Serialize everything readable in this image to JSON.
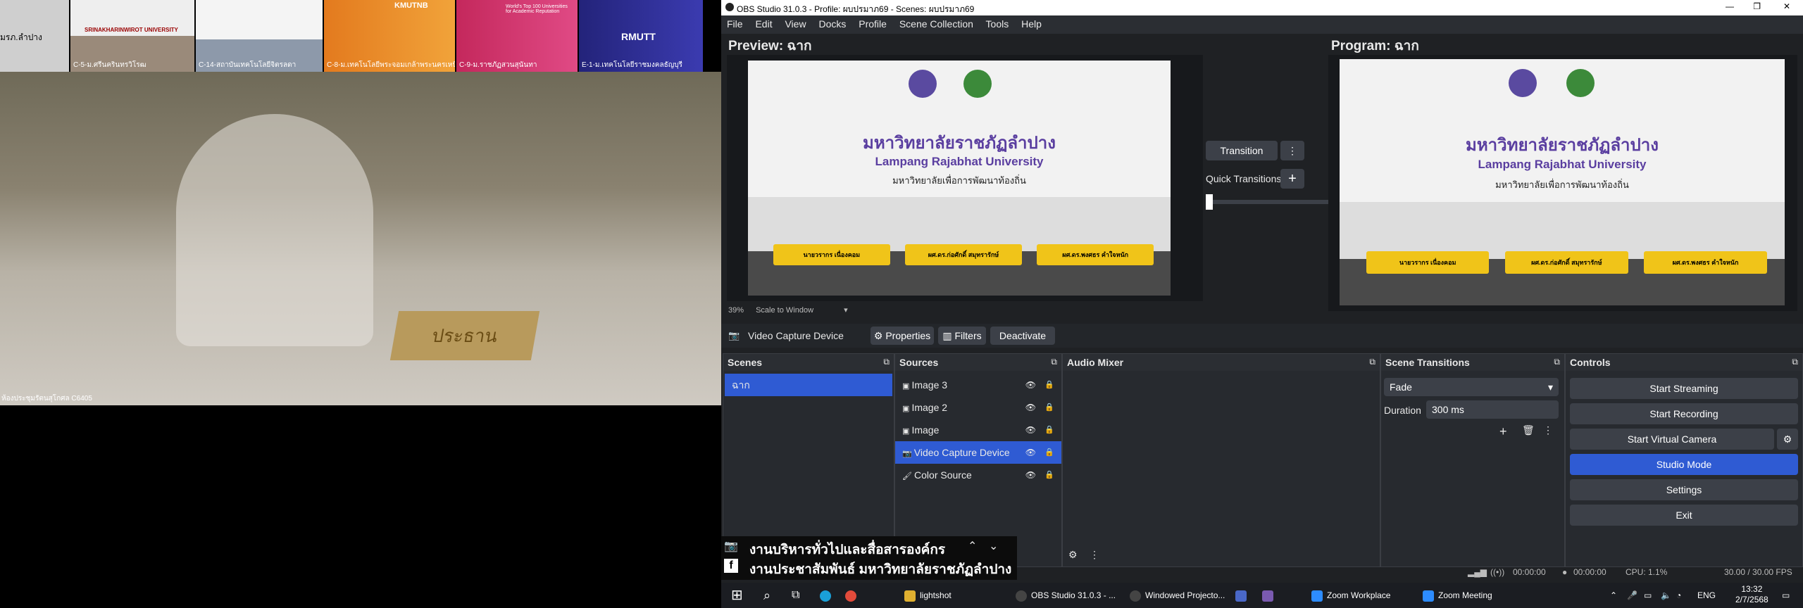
{
  "left": {
    "thumbs": [
      {
        "label": "มรภ.ลำปาง",
        "caption": ""
      },
      {
        "label": "SRINAKHARINWIROT UNIVERSITY",
        "caption": "C-5-ม.ศรีนครินทรวิโรฒ"
      },
      {
        "label": "",
        "caption": "C-14-สถาบันเทคโนโลยีจิตรลดา"
      },
      {
        "label": "KMUTNB",
        "caption": "C-8-ม.เทคโนโลยีพระจอมเกล้าพระนครเหนือ"
      },
      {
        "label": "World's Top 100 Universities for Academic Reputation",
        "caption": "C-9-ม.ราชภัฏสวนสุนันทา"
      },
      {
        "label": "RMUTT",
        "caption": "E-1-ม.เทคโนโลยีราชมงคลธัญบุรี"
      }
    ],
    "main_caption": "ห้องประชุมรัตนสุโกศล C6405",
    "sign": "ประธาน"
  },
  "overlay": {
    "line1": "งานบริหารทั่วไปและสื่อสารองค์กร",
    "line2": "งานประชาสัมพันธ์ มหาวิทยาลัยราชภัฏลำปาง"
  },
  "obs": {
    "title": "OBS Studio 31.0.3 - Profile: ผบปรมาภ69 - Scenes: ผบปรมาภ69",
    "menu": [
      "File",
      "Edit",
      "View",
      "Docks",
      "Profile",
      "Scene Collection",
      "Tools",
      "Help"
    ],
    "preview_label": "Preview: ฉาก",
    "program_label": "Program: ฉาก",
    "transition_button": "Transition",
    "quick_transitions": "Quick Transitions",
    "zoom": "39%",
    "scale": "Scale to Window",
    "screen": {
      "uni_th": "มหาวิทยาลัยราชภัฏลำปาง",
      "uni_en": "Lampang Rajabhat University",
      "motto": "มหาวิทยาลัยเพื่อการพัฒนาท้องถิ่น",
      "names": [
        "นายวรากร เนื่องคอม",
        "ผศ.ดร.ก่อศักดิ์ สมุทรารักษ์",
        "ผศ.ดร.พงศธร คำใจหนัก"
      ]
    },
    "source_toolbar": {
      "selected": "Video Capture Device",
      "properties": "Properties",
      "filters": "Filters",
      "deactivate": "Deactivate"
    },
    "scenes": {
      "title": "Scenes",
      "items": [
        "ฉาก"
      ]
    },
    "sources": {
      "title": "Sources",
      "items": [
        "Image 3",
        "Image 2",
        "Image",
        "Video Capture Device",
        "Color Source"
      ]
    },
    "audio_mixer": {
      "title": "Audio Mixer"
    },
    "scene_transitions": {
      "title": "Scene Transitions",
      "type": "Fade",
      "duration_label": "Duration",
      "duration_value": "300 ms"
    },
    "controls": {
      "title": "Controls",
      "buttons": [
        "Start Streaming",
        "Start Recording",
        "Start Virtual Camera",
        "Studio Mode",
        "Settings",
        "Exit"
      ]
    },
    "status": {
      "stream_time": "00:00:00",
      "rec_time": "00:00:00",
      "cpu": "CPU: 1.1%",
      "fps": "30.00 / 30.00 FPS"
    }
  },
  "taskbar": {
    "items": [
      "lightshot",
      "OBS Studio 31.0.3 - ...",
      "Windowed Projecto...",
      "Zoom Workplace",
      "Zoom Meeting"
    ],
    "lang": "ENG",
    "time": "13:32",
    "date": "2/7/2568"
  }
}
